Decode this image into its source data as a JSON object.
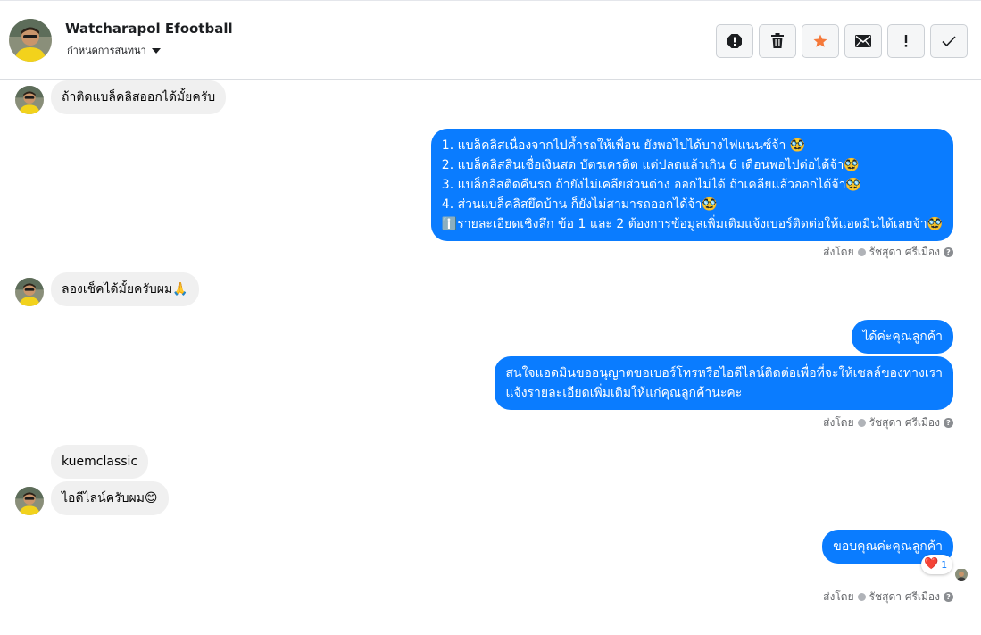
{
  "header": {
    "contact_name": "Watcharapol Efootball",
    "assign_label": "กำหนดการสนทนา",
    "toolbar": [
      "spam-icon",
      "trash-icon",
      "star-icon",
      "mail-icon",
      "exclamation-icon",
      "check-icon"
    ],
    "accent_color": "#f5793a"
  },
  "messages": {
    "m1": "ถ้าติดแบล็คลิสออกได้มั้ยครับ",
    "m2": [
      "1. แบล็คลิสเนื่องจากไปค้ำรถให้เพื่อน ยังพอไปได้บางไฟแนนซ์จ้า 🥸",
      "2. แบล็คลิสสินเชื่อเงินสด บัตรเครดิต แต่ปลดแล้วเกิน 6 เดือนพอไปต่อได้จ้า🥸",
      "3. แบล็กลิสติดคืนรถ ถ้ายังไม่เคลียส่วนต่าง ออกไม่ได้ ถ้าเคลียแล้วออกได้จ้า🥸",
      "4. ส่วนแบล็คลิสยึดบ้าน ก็ยังไม่สามารถออกได้จ้า🥸",
      "ℹ️รายละเอียดเชิงลึก ข้อ 1 และ 2 ต้องการข้อมูลเพิ่มเติมแจ้งเบอร์ติดต่อให้แอดมินได้เลยจ้า🥸"
    ],
    "m3": "ลองเช็คได้มั้ยครับผม🙏",
    "m4": "ได้ค่ะคุณลูกค้า",
    "m5": [
      "สนใจแอดมินขออนุญาตขอเบอร์โทรหรือไอดีไลน์ติดต่อเพื่อที่จะให้เซลล์ของทางเรา",
      "แจ้งรายละเอียดเพิ่มเติมให้แก่คุณลูกค้านะคะ"
    ],
    "m6": "kuemclassic",
    "m7": "ไอดีไลน์ครับผม😊",
    "m8": "ขอบคุณค่ะคุณลูกค้า"
  },
  "sent_by": {
    "prefix": "ส่งโดย",
    "agent": "รัชสุดา ศรีเมือง"
  },
  "reaction": {
    "emoji": "❤️",
    "count": "1"
  },
  "colors": {
    "outgoing_bubble": "#0a7cff",
    "incoming_bubble": "#f0f0f0"
  }
}
